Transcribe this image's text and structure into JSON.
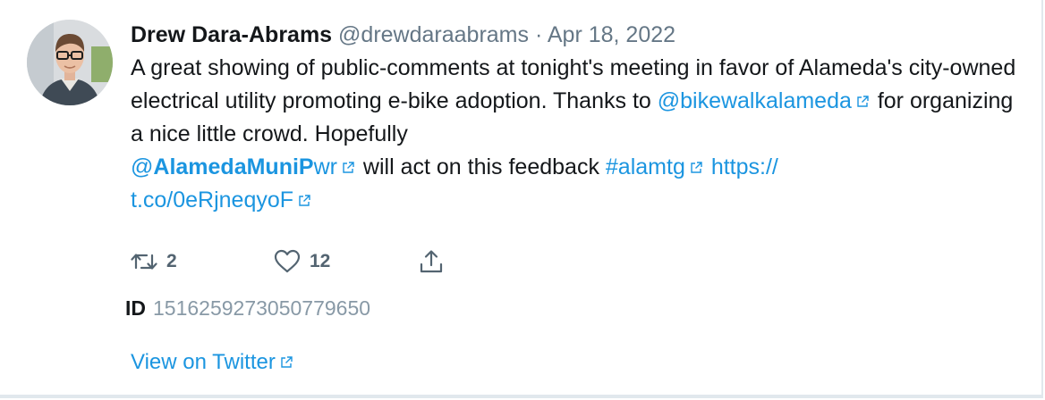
{
  "tweet": {
    "author_name": "Drew Dara-Abrams",
    "handle": "@drewdaraabrams",
    "separator": "·",
    "date": "Apr 18, 2022",
    "text_1": "A great showing of public-comments at tonight's meeting in favor of Alameda's city-owned electrical utility promoting e-bike adoption. Thanks to ",
    "mention_1": "@bikewalkalameda",
    "text_2": " for organizing a nice little crowd. Hopefully ",
    "mention_2_at": "@",
    "mention_2_bold": "AlamedaMuniP",
    "mention_2_rest": "wr",
    "text_3": " will act on this feedback ",
    "hashtag": "#alamtg",
    "url_part_1": "https://",
    "url_part_2": "t.co/0eRjneqyoF"
  },
  "actions": {
    "retweet_count": "2",
    "like_count": "12"
  },
  "id_row": {
    "label": "ID",
    "value": "1516259273050779650"
  },
  "footer": {
    "view_link": "View on Twitter"
  },
  "colors": {
    "link": "#1b95e0",
    "text": "#14171a",
    "muted": "#657786",
    "border": "#e1e8ed"
  },
  "icons": [
    "avatar-photo",
    "external-link-icon",
    "retweet-icon",
    "heart-icon",
    "share-icon"
  ]
}
